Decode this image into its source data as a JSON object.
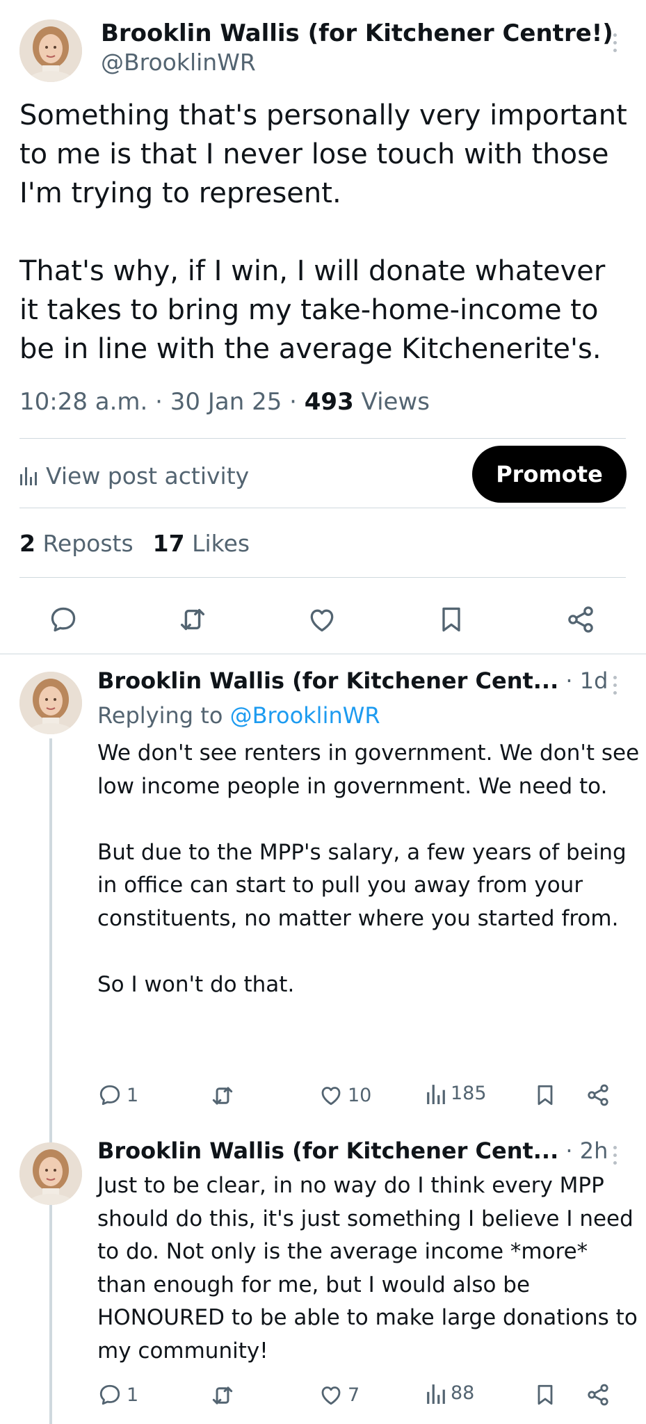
{
  "main_post": {
    "author_name": "Brooklin Wallis (for Kitchener Centre!)",
    "handle": "@BrooklinWR",
    "text": "Something that's personally very important to me is that I never lose touch with those I'm trying to represent.\n\nThat's why, if I win, I will donate whatever it takes to bring my take-home-income to be in line with the average Kitchenerite's.",
    "timestamp": "10:28 a.m. · 30 Jan 25 · ",
    "views_count": "493",
    "views_label": " Views",
    "activity_label": "View post activity",
    "promote_label": "Promote",
    "reposts_count": "2",
    "reposts_label": " Reposts",
    "likes_count": "17",
    "likes_label": " Likes",
    "actions": [
      "reply-icon",
      "repost-icon",
      "like-icon",
      "bookmark-icon",
      "share-icon"
    ]
  },
  "replies": [
    {
      "author_name": "Brooklin Wallis (for Kitchener Cent...",
      "time": " · 1d",
      "replying_prefix": "Replying to ",
      "replying_handle": "@BrooklinWR",
      "text": "We don't see renters in government. We don't see low income people in government. We need to.\n\nBut due to the MPP's salary, a few years of being in office can start to pull you away from your constituents, no matter where you started from.\n\nSo I won't do that.",
      "replies": "1",
      "likes": "10",
      "views": "185"
    },
    {
      "author_name": "Brooklin Wallis (for Kitchener Cent...",
      "time": " · 2h",
      "text": "Just to be clear, in no way do I think every MPP should do this, it's just something I believe I need to do. Not only is the average income *more* than enough for me, but I would also be HONOURED to be able to make large donations to my community!",
      "replies": "1",
      "likes": "7",
      "views": "88"
    }
  ],
  "colors": {
    "text": "#0f1419",
    "secondary": "#536471",
    "link": "#1d9bf0",
    "divider": "#cfd9de",
    "promote_bg": "#000000"
  }
}
